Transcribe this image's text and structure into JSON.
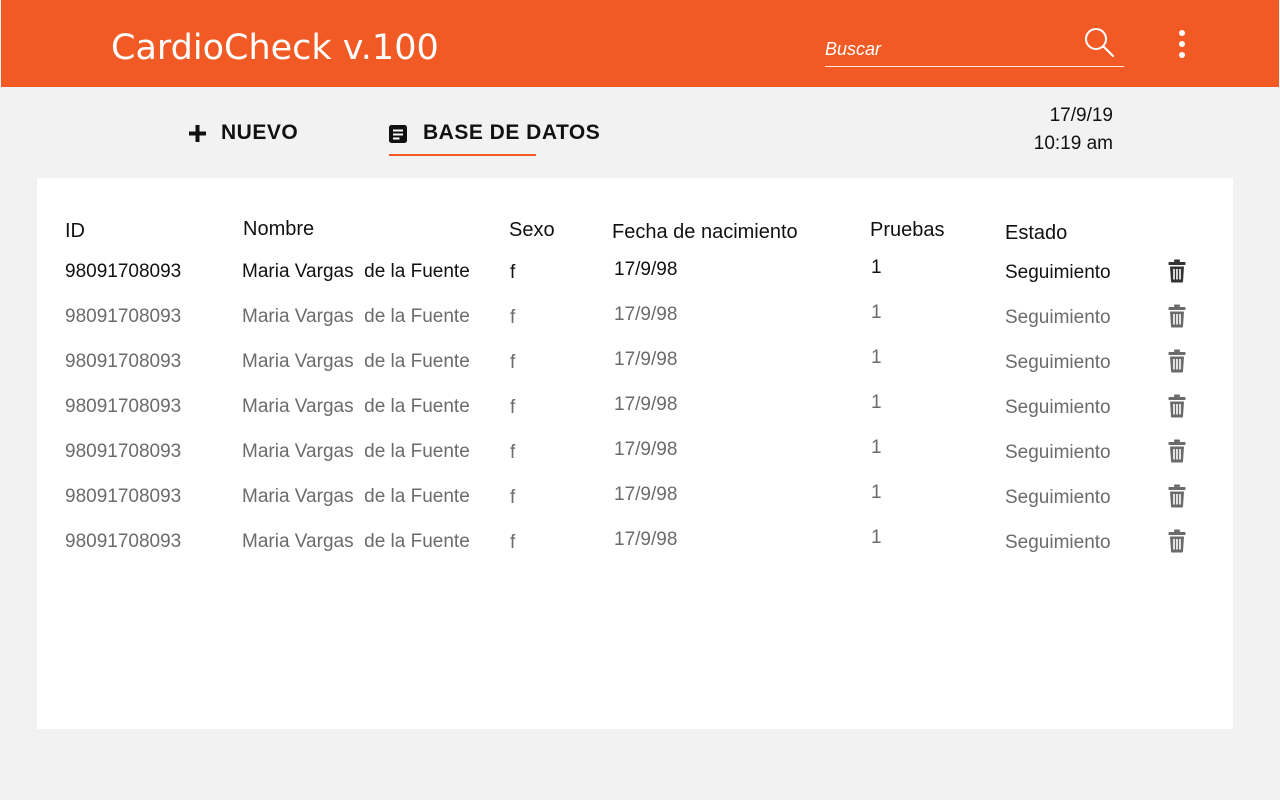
{
  "app": {
    "title": "CardioCheck v.100"
  },
  "search": {
    "placeholder": "Buscar",
    "icon": "search-icon"
  },
  "menu": {
    "icon": "more-vertical-icon"
  },
  "toolbar": {
    "new_label": "NUEVO",
    "new_icon": "plus-icon",
    "database_label": "BASE DE DATOS",
    "database_icon": "document-icon",
    "active_tab": "database"
  },
  "datetime": {
    "date": "17/9/19",
    "time": "10:19 am"
  },
  "table": {
    "columns": [
      "ID",
      "Nombre",
      "Sexo",
      "Fecha de nacimiento",
      "Pruebas",
      "Estado"
    ],
    "rows": [
      {
        "id": "98091708093",
        "name": "Maria Vargas  de la Fuente",
        "sex": "f",
        "birth": "17/9/98",
        "tests": "1",
        "status": "Seguimiento"
      },
      {
        "id": "98091708093",
        "name": "Maria Vargas  de la Fuente",
        "sex": "f",
        "birth": "17/9/98",
        "tests": "1",
        "status": "Seguimiento"
      },
      {
        "id": "98091708093",
        "name": "Maria Vargas  de la Fuente",
        "sex": "f",
        "birth": "17/9/98",
        "tests": "1",
        "status": "Seguimiento"
      },
      {
        "id": "98091708093",
        "name": "Maria Vargas  de la Fuente",
        "sex": "f",
        "birth": "17/9/98",
        "tests": "1",
        "status": "Seguimiento"
      },
      {
        "id": "98091708093",
        "name": "Maria Vargas  de la Fuente",
        "sex": "f",
        "birth": "17/9/98",
        "tests": "1",
        "status": "Seguimiento"
      },
      {
        "id": "98091708093",
        "name": "Maria Vargas  de la Fuente",
        "sex": "f",
        "birth": "17/9/98",
        "tests": "1",
        "status": "Seguimiento"
      },
      {
        "id": "98091708093",
        "name": "Maria Vargas  de la Fuente",
        "sex": "f",
        "birth": "17/9/98",
        "tests": "1",
        "status": "Seguimiento"
      }
    ],
    "row_action_icon": "trash-icon"
  },
  "colors": {
    "accent": "#f15a24",
    "background": "#f2f2f2",
    "card": "#ffffff",
    "text_primary": "#111111",
    "text_secondary": "#6b6b6b"
  }
}
